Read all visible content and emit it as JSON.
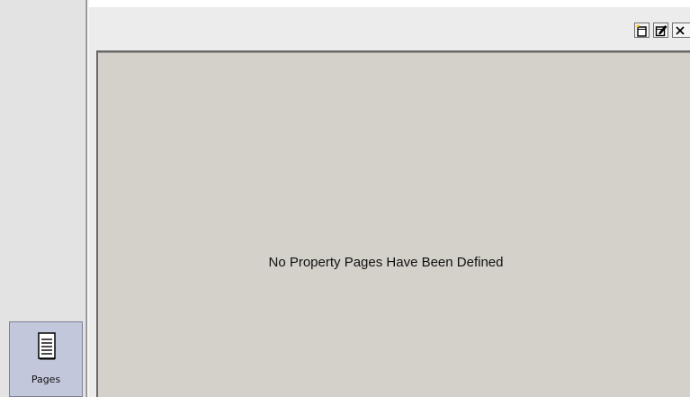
{
  "sidebar": {
    "items": [
      {
        "label": "Pages",
        "icon": "document-icon",
        "selected": true
      }
    ]
  },
  "toolbar": {
    "buttons": [
      {
        "name": "new-page-button",
        "icon": "new-page-icon"
      },
      {
        "name": "edit-page-button",
        "icon": "edit-icon"
      },
      {
        "name": "close-button",
        "icon": "close-icon"
      }
    ]
  },
  "panel": {
    "empty_message": "No Property Pages Have Been Defined"
  },
  "colors": {
    "sidebar_bg": "#e3e3e3",
    "selected_tile_bg": "#c3c7dc",
    "panel_bg": "#d4d0ca",
    "toolbar_bg": "#ececec"
  }
}
